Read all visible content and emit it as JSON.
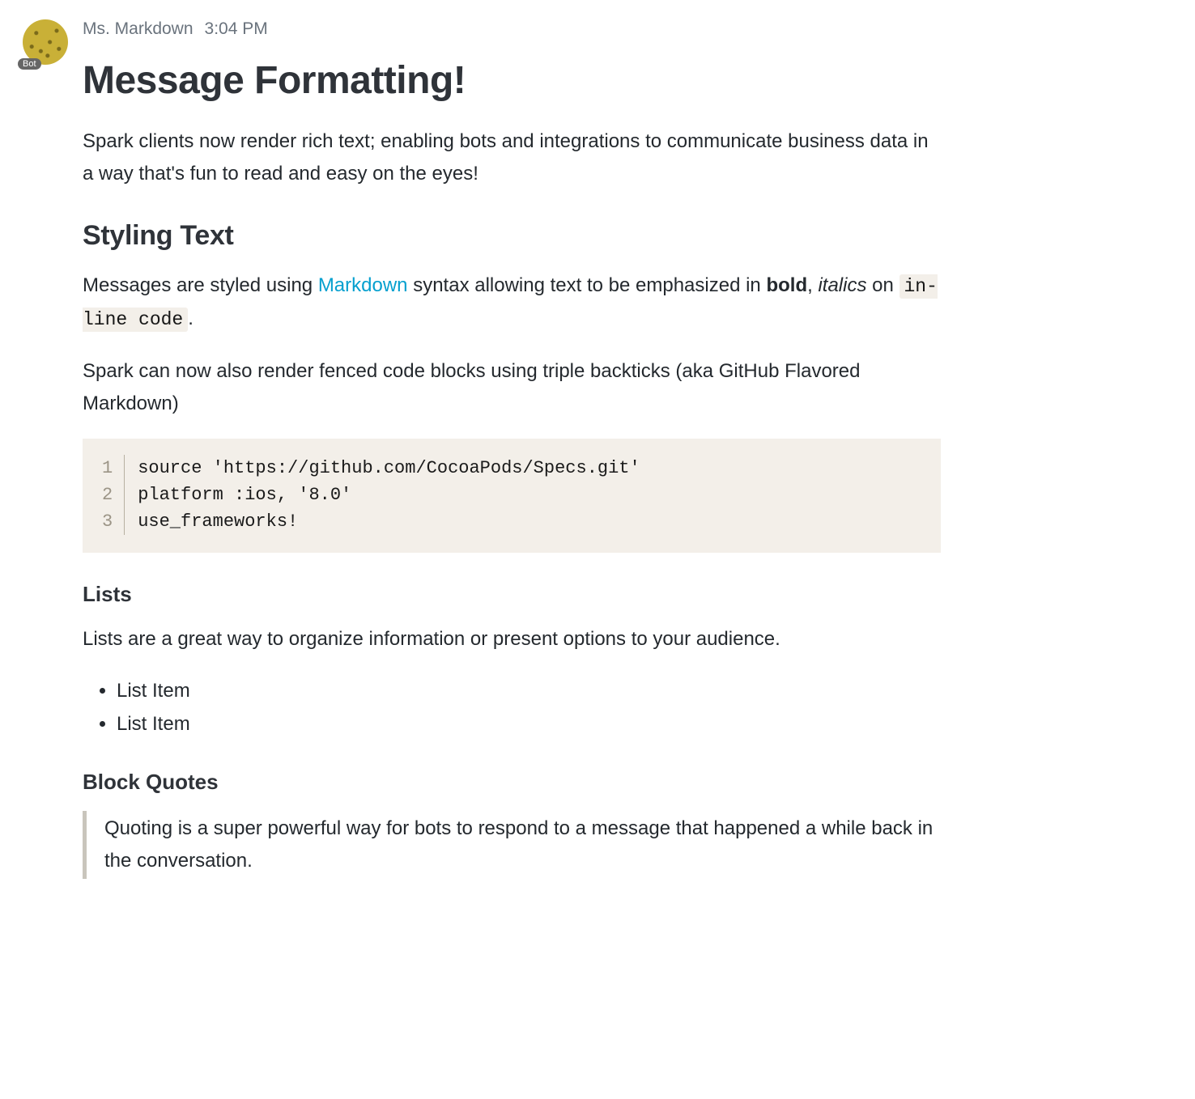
{
  "author": "Ms. Markdown",
  "timestamp": "3:04 PM",
  "bot_badge": "Bot",
  "h1": "Message Formatting!",
  "intro": "Spark clients now render rich text; enabling bots and integrations to communicate business data in a way that's fun to read and easy on the eyes!",
  "h2_styling": "Styling Text",
  "styling_para": {
    "pre": "Messages are styled using ",
    "link": "Markdown",
    "mid1": " syntax allowing text to be emphasized in ",
    "bold": "bold",
    "mid2": ", ",
    "italic": "italics",
    "mid3": " on ",
    "code": "in-line code",
    "post": "."
  },
  "fenced_para": "Spark can now also render fenced code blocks using triple backticks (aka GitHub Flavored Markdown)",
  "code": {
    "gutter": [
      "1",
      "2",
      "3"
    ],
    "lines": [
      "source 'https://github.com/CocoaPods/Specs.git'",
      "platform :ios, '8.0'",
      "use_frameworks!"
    ]
  },
  "h3_lists": "Lists",
  "lists_para": "Lists are a great way to organize information or present options to your audience.",
  "list_items": [
    "List Item",
    "List Item"
  ],
  "h3_quotes": "Block Quotes",
  "quote": "Quoting is a super powerful way for bots to respond to a message that happened a while back in the conversation."
}
